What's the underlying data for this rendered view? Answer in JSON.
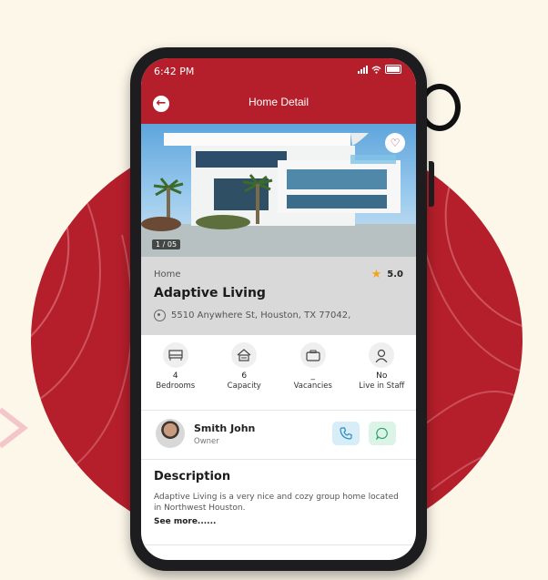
{
  "status_bar": {
    "time": "6:42 PM"
  },
  "app_bar": {
    "title": "Home Detail"
  },
  "hero": {
    "image_counter": "1 / 05"
  },
  "listing": {
    "category": "Home",
    "rating": "5.0",
    "name": "Adaptive Living",
    "address": "5510 Anywhere St, Houston, TX 77042,"
  },
  "features": [
    {
      "icon": "bed-icon",
      "value": "4",
      "label": "Bedrooms"
    },
    {
      "icon": "home-capacity-icon",
      "value": "6",
      "label": "Capacity"
    },
    {
      "icon": "briefcase-icon",
      "value": "_",
      "label": "Vacancies"
    },
    {
      "icon": "staff-icon",
      "value": "No",
      "label": "Live in Staff"
    }
  ],
  "owner": {
    "name": "Smith John",
    "role": "Owner"
  },
  "description": {
    "title": "Description",
    "text": "Adaptive Living is a very nice and cozy group home located in Northwest Houston.",
    "see_more": "See more......"
  },
  "colors": {
    "brand": "#b51f2b",
    "star": "#f2a51a",
    "call_bg": "#d7eef8",
    "chat_bg": "#dcf4e8"
  }
}
